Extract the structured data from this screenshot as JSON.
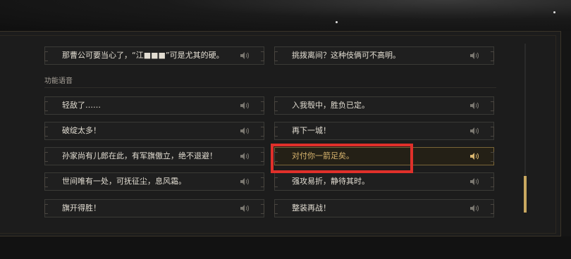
{
  "rows_top": [
    {
      "left": "那曹公可要当心了，“江■■■”可是尤其的硬。",
      "right": "挑拨离间？这种伎俩可不高明。"
    }
  ],
  "section": {
    "title": "功能语音"
  },
  "rows": [
    {
      "left": "轻敌了……",
      "right": "入我彀中，胜负已定。"
    },
    {
      "left": "破绽太多！",
      "right": "再下一城！"
    },
    {
      "left": "孙家尚有儿郎在此，有军旗傲立，绝不退避！",
      "right": "对付你一箭足矣。"
    },
    {
      "left": "世间唯有一处，可抚征尘，息风霜。",
      "right": "强攻易折，静待其时。"
    },
    {
      "left": "旗开得胜！",
      "right": "整装再战！"
    }
  ],
  "selected": {
    "row": 2,
    "side": "right"
  },
  "colors": {
    "accent": "#c9a860",
    "highlight": "#e0302a"
  },
  "icons": {
    "voice": "speaker-icon"
  }
}
